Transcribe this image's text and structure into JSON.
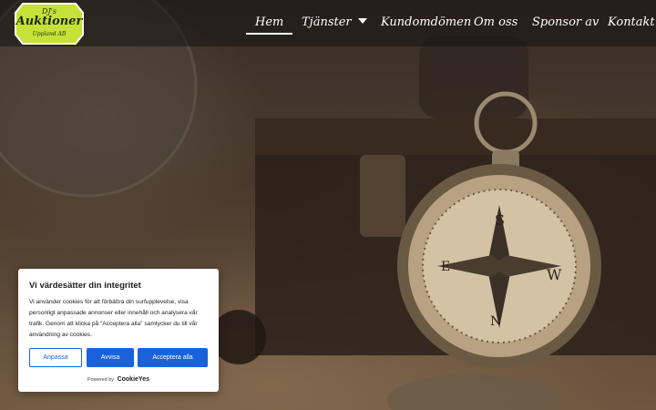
{
  "brand": {
    "top": "DJ's",
    "name": "Auktioner",
    "sub": "Uppland AB"
  },
  "nav": {
    "items": [
      {
        "label": "Hem",
        "active": true
      },
      {
        "label": "Tjänster",
        "has_dropdown": true
      },
      {
        "label": "Kundomdömen"
      },
      {
        "label": "Om oss"
      },
      {
        "label": "Sponsor av"
      },
      {
        "label": "Kontakt"
      }
    ]
  },
  "cookie": {
    "title": "Vi värdesätter din integritet",
    "text": "Vi använder cookies för att förbättra din surfupplevelse, visa personligt anpassade annonser eller innehåll och analysera vår trafik. Genom att klicka på \"Acceptera alla\" samtycker du till vår användning av cookies.",
    "customize_label": "Anpassa",
    "reject_label": "Avvisa",
    "accept_label": "Acceptera alla",
    "powered_by": "Powered by",
    "powered_brand": "CookieYes"
  },
  "colors": {
    "accent": "#1863dc",
    "logo_green": "#c6e23a",
    "header_bg": "#141210"
  }
}
